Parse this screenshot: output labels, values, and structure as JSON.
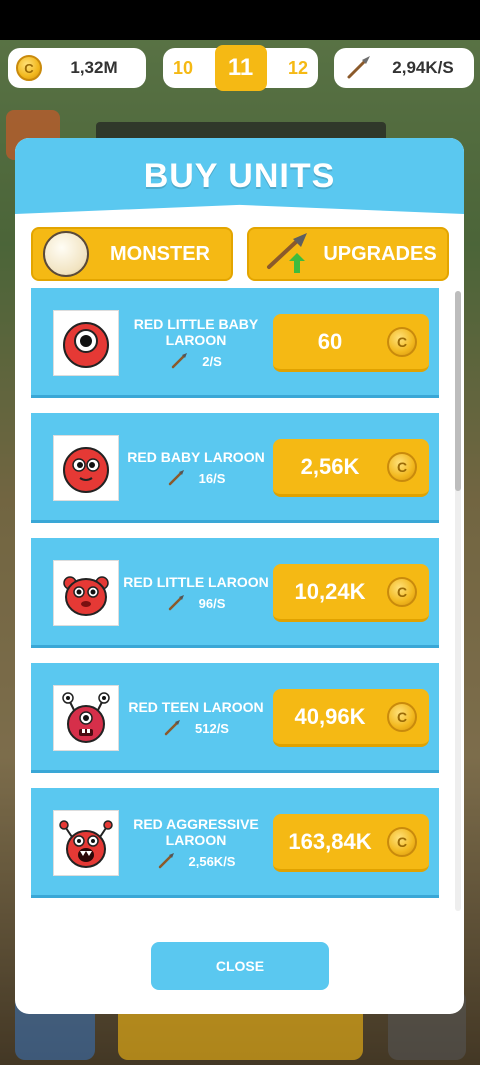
{
  "hud": {
    "coins": "1,32M",
    "level_prev": "10",
    "level_current": "11",
    "level_next": "12",
    "dps": "2,94K/S"
  },
  "modal": {
    "title": "BUY UNITS",
    "tabs": [
      {
        "label": "MONSTER",
        "icon": "egg-icon"
      },
      {
        "label": "UPGRADES",
        "icon": "spear-upgrade-icon"
      }
    ],
    "units": [
      {
        "name": "RED LITTLE BABY LAROON",
        "rate": "2/S",
        "price": "60",
        "icon": "red-little-baby-laroon"
      },
      {
        "name": "RED BABY LAROON",
        "rate": "16/S",
        "price": "2,56K",
        "icon": "red-baby-laroon"
      },
      {
        "name": "RED LITTLE LAROON",
        "rate": "96/S",
        "price": "10,24K",
        "icon": "red-little-laroon"
      },
      {
        "name": "RED TEEN LAROON",
        "rate": "512/S",
        "price": "40,96K",
        "icon": "red-teen-laroon"
      },
      {
        "name": "RED AGGRESSIVE LAROON",
        "rate": "2,56K/S",
        "price": "163,84K",
        "icon": "red-aggressive-laroon"
      }
    ],
    "close_label": "CLOSE"
  },
  "colors": {
    "accent_blue": "#5ac8f0",
    "accent_gold": "#f5b914",
    "monster_red": "#e53935"
  }
}
